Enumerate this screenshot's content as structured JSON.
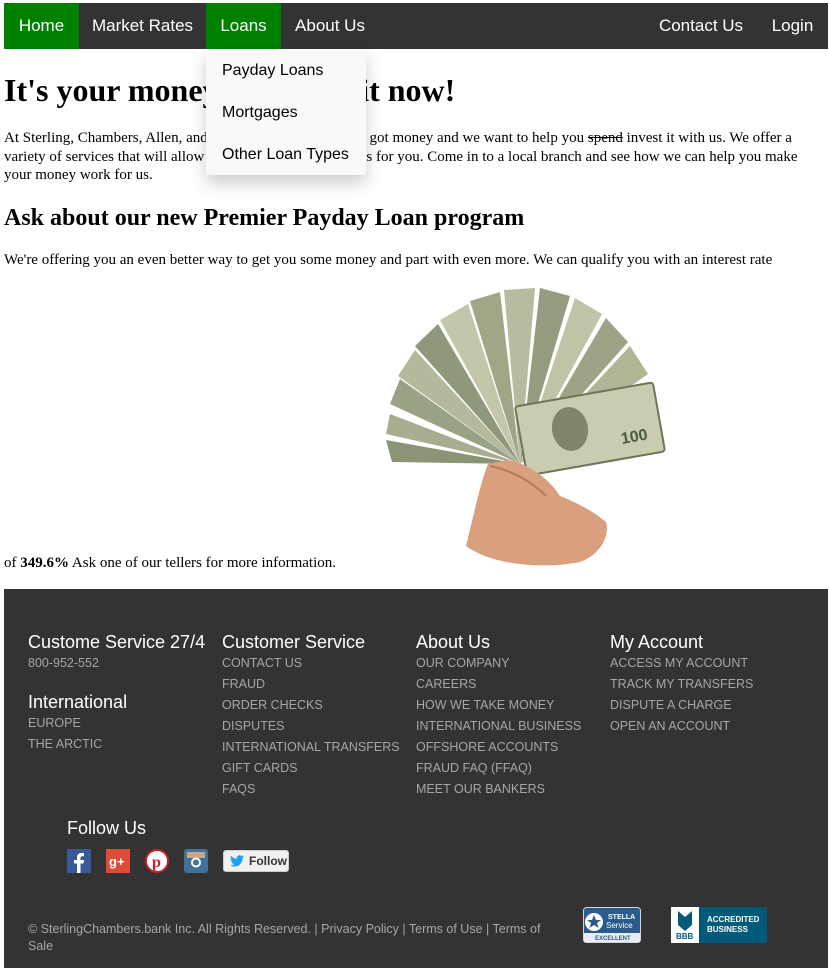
{
  "nav": {
    "home": "Home",
    "market_rates": "Market Rates",
    "loans": "Loans",
    "about_us": "About Us",
    "contact_us": "Contact Us",
    "login": "Login"
  },
  "loans_dropdown": [
    "Payday Loans",
    "Mortgages",
    "Other Loan Types"
  ],
  "main": {
    "headline": "It's your money. We want it now!",
    "intro_start": "At Sterling, Chambers, Allen, and Partners, we know you've got money and we want to help you ",
    "intro_struck": "spend",
    "intro_end": " invest it with us. We offer a variety of services that will allow us to manage your finances for you. Come in to a local branch and see how we can help you make your money work for us.",
    "subheadline": "Ask about our new Premier Payday Loan program",
    "offer_text": "We're offering you an even better way to get you some money and part with even more. We can qualify you with an interest rate",
    "rate_prefix": "of ",
    "rate": "349.6%",
    "rate_suffix": " Ask one of our tellers for more information."
  },
  "footer": {
    "columns": [
      {
        "title": "Custome Service 27/4",
        "links": [
          "800-952-552"
        ]
      },
      {
        "title": "Customer Service",
        "links": [
          "CONTACT US",
          "FRAUD",
          "ORDER CHECKS",
          "DISPUTES",
          "INTERNATIONAL TRANSFERS",
          "GIFT CARDS",
          "FAQS"
        ]
      },
      {
        "title": "About Us",
        "links": [
          "OUR COMPANY",
          "CAREERS",
          "HOW WE TAKE MONEY",
          "INTERNATIONAL BUSINESS",
          "OFFSHORE ACCOUNTS",
          "FRAUD FAQ (FFAQ)",
          "MEET OUR BANKERS"
        ]
      },
      {
        "title": "My Account",
        "links": [
          "ACCESS MY ACCOUNT",
          "TRACK MY TRANSFERS",
          "DISPUTE A CHARGE",
          "OPEN AN ACCOUNT"
        ]
      }
    ],
    "international": {
      "title": "International",
      "links": [
        "EUROPE",
        "THE ARCTIC"
      ]
    },
    "follow_us": "Follow Us",
    "social_icons": [
      "facebook-icon",
      "google-plus-icon",
      "pinterest-icon",
      "instagram-icon"
    ],
    "twitter_follow": "Follow",
    "copyright": "© SterlingChambers.bank Inc. All Rights Reserved. | ",
    "privacy": "Privacy Policy",
    "sep": " | ",
    "terms_use": "Terms of Use",
    "terms_sale": "Terms of Sale",
    "stella_badge": {
      "line1": "STELLA",
      "line2": "Service",
      "line3": "EXCELLENT"
    },
    "bbb_badge": {
      "logo": "BBB",
      "line1": "ACCREDITED",
      "line2": "BUSINESS"
    }
  },
  "colors": {
    "nav_bg": "#333333",
    "active": "#008000",
    "footer_bg": "#333333",
    "link_gray": "#a6a6a6"
  }
}
